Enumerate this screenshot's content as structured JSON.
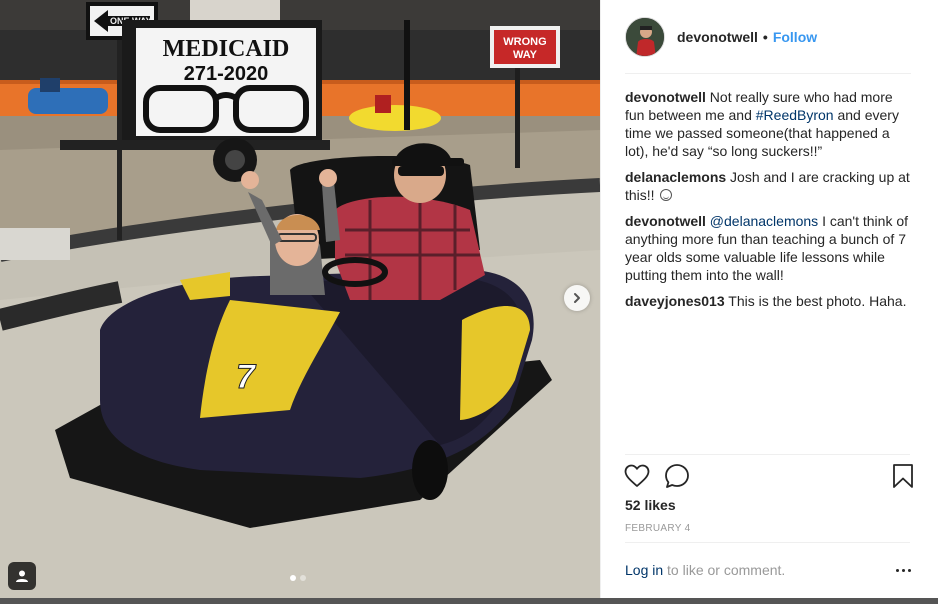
{
  "photo": {
    "signs": {
      "one_way": "ONE WAY",
      "medicaid_title": "MEDICAID",
      "medicaid_number": "271-2020",
      "wrong_way_line1": "WRONG",
      "wrong_way_line2": "WAY"
    },
    "kart_number": "7",
    "carousel": {
      "total": 2,
      "active_index": 0
    }
  },
  "post": {
    "author": "devonotwell",
    "separator": "•",
    "follow_label": "Follow",
    "comments": [
      {
        "user": "devonotwell",
        "text_before": " Not really sure who had more fun between me and ",
        "hashtag": "#ReedByron",
        "text_after": " and every time we passed someone(that happened a lot), he'd say “so long suckers!!”"
      },
      {
        "user": "delanaclemons",
        "text": " Josh and I are cracking up at this!! "
      },
      {
        "user": "devonotwell",
        "mention": "@delanaclemons",
        "text": " I can't think of anything more fun than teaching a bunch of 7 year olds some valuable life lessons while putting them into the wall!"
      },
      {
        "user": "daveyjones013",
        "text": " This is the best photo. Haha."
      }
    ],
    "likes": "52 likes",
    "date": "February 4",
    "login_link": "Log in",
    "login_suffix": " to like or comment."
  },
  "icons": {
    "like": "heart-icon",
    "comment": "speech-bubble-icon",
    "save": "bookmark-icon",
    "more": "more-horizontal-icon",
    "next": "chevron-right-icon",
    "tag": "user-tag-icon"
  },
  "colors": {
    "follow": "#3897f0",
    "link": "#003569",
    "muted": "#999999",
    "text": "#262626"
  }
}
